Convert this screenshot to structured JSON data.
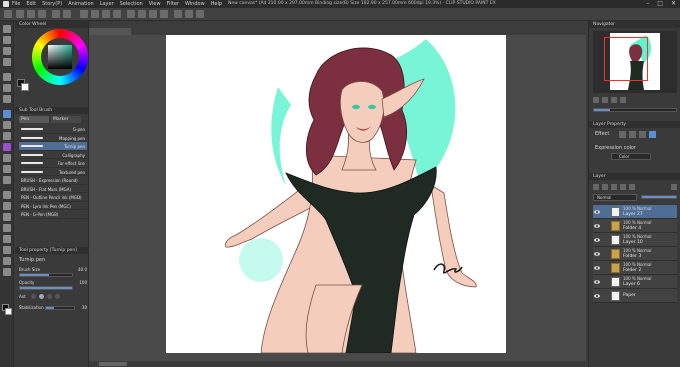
{
  "app": {
    "menu": [
      "File",
      "Edit",
      "Story(P)",
      "Animation",
      "Layer",
      "Selection",
      "View",
      "Filter",
      "Window",
      "Help"
    ],
    "doc_title": "New canvas* (Ad 210.00 x 297.00mm Binding size(B) Size 182.90 x 257.00mm 600dpi 19.3%) - CLIP STUDIO PAINT EX",
    "window_controls": [
      "–",
      "□",
      "✕"
    ]
  },
  "left_panel": {
    "color_wheel_title": "Color Wheel",
    "sub_tool_title": "Sub Tool Brush",
    "tabs": [
      "Pen",
      "Marker"
    ],
    "brushes": [
      {
        "label": "G-pen",
        "selected": false
      },
      {
        "label": "Mapping pen",
        "selected": false
      },
      {
        "label": "Turnip pen",
        "selected": true
      },
      {
        "label": "Calligraphy",
        "selected": false
      },
      {
        "label": "For effect line",
        "selected": false
      },
      {
        "label": "Textured pen",
        "selected": false
      },
      {
        "label": "BRUSH - Expression (Round)",
        "selected": false
      },
      {
        "label": "BRUSH - Flat Mars (MGA)",
        "selected": false
      },
      {
        "label": "PEN - Outline Pencil ink (MGD)",
        "selected": false
      },
      {
        "label": "PEN - Lyra Ink Pen (MGC)",
        "selected": false
      },
      {
        "label": "PEN - G-Pen (MGB)",
        "selected": false
      }
    ],
    "tool_property_title": "Tool property [Turnip pen]",
    "tool_name": "Turnip pen",
    "brush_size_label": "Brush Size",
    "brush_size_value": "40.0",
    "brush_size_fraction": 0.55,
    "opacity_label": "Opacity",
    "opacity_value": "100",
    "opacity_fraction": 1.0,
    "anti_alias_label": "Ant",
    "stabilization_label": "Stabilization",
    "stabilization_value": "30",
    "stabilization_fraction": 0.3
  },
  "canvas": {
    "tab_label": "New canvas*"
  },
  "right_panel": {
    "navigator_title": "Navigator",
    "layer_property_title": "Layer Property",
    "effect_label": "Effect",
    "expression_color_label": "Expression color",
    "color_option": "Color",
    "layer_title": "Layer",
    "blend_mode": "Normal",
    "layers": [
      {
        "blend": "100 % Normal",
        "name": "Layer 27",
        "type": "layer",
        "selected": true
      },
      {
        "blend": "100 % Normal",
        "name": "Folder 4",
        "type": "folder",
        "selected": false
      },
      {
        "blend": "100 % Normal",
        "name": "Layer 10",
        "type": "layer",
        "selected": false
      },
      {
        "blend": "100 % Normal",
        "name": "Folder 3",
        "type": "folder",
        "selected": false
      },
      {
        "blend": "100 % Normal",
        "name": "Folder 2",
        "type": "folder",
        "selected": false
      },
      {
        "blend": "100 % Normal",
        "name": "Layer 6",
        "type": "layer",
        "selected": false
      },
      {
        "blend": "",
        "name": "Paper",
        "type": "layer",
        "selected": false
      }
    ]
  },
  "colors": {
    "accent_selection": "#4e6e96",
    "teal_glow": "#5ff3cf",
    "hair": "#7c2f3e",
    "dress": "#1f2b22",
    "skin": "#f4cdbd"
  }
}
